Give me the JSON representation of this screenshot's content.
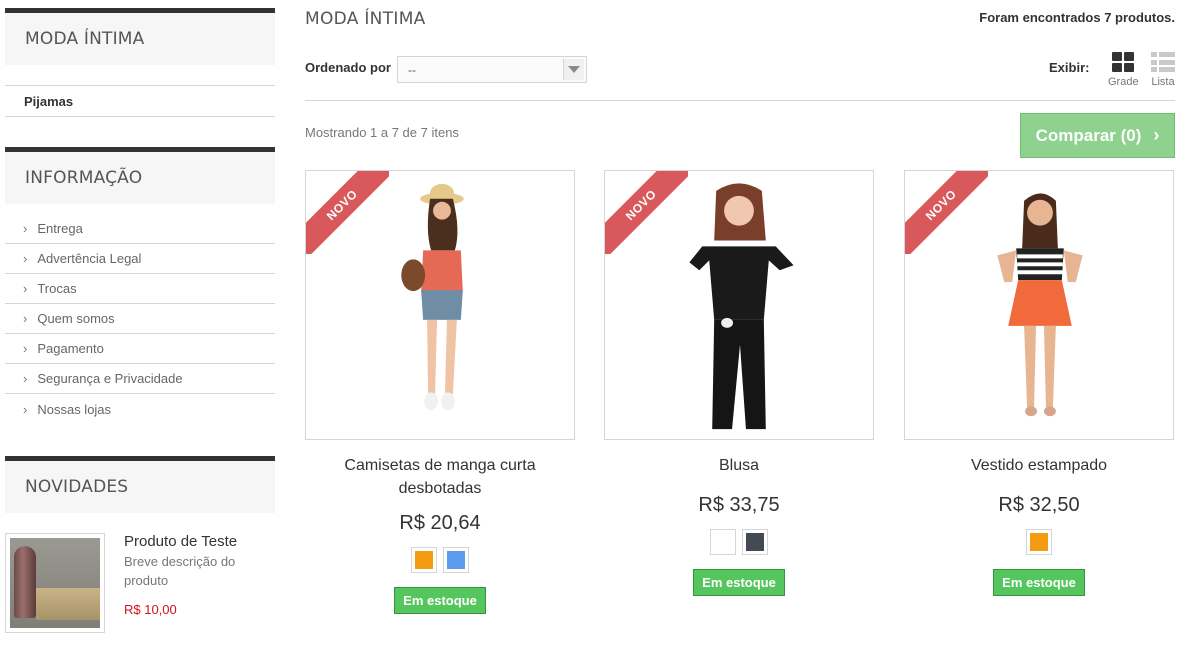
{
  "sidebar": {
    "category_title": "MODA ÍNTIMA",
    "category_items": [
      "Pijamas"
    ],
    "info_title": "INFORMAÇÃO",
    "info_items": [
      "Entrega",
      "Advertência Legal",
      "Trocas",
      "Quem somos",
      "Pagamento",
      "Segurança e Privacidade",
      "Nossas lojas"
    ],
    "new_title": "NOVIDADES",
    "new_product": {
      "name": "Produto de Teste",
      "description": "Breve descrição do produto",
      "price": "R$ 10,00"
    }
  },
  "main": {
    "title": "MODA ÍNTIMA",
    "found_text": "Foram encontrados 7 produtos.",
    "sort_label": "Ordenado por",
    "sort_value": "--",
    "view_label": "Exibir:",
    "view_grid": "Grade",
    "view_list": "Lista",
    "showing": "Mostrando 1 a 7 de 7 itens",
    "compare_label": "Comparar (0)"
  },
  "products": [
    {
      "badge": "NOVO",
      "name": "Camisetas de manga curta desbotadas",
      "price": "R$ 20,64",
      "swatches": [
        "#f39c11",
        "#5d9cec"
      ],
      "stock": "Em estoque",
      "icon": "model-photo-1"
    },
    {
      "badge": "NOVO",
      "name": "Blusa",
      "price": "R$ 33,75",
      "swatches": [
        "#ffffff",
        "#434a54"
      ],
      "stock": "Em estoque",
      "icon": "model-photo-2"
    },
    {
      "badge": "NOVO",
      "name": "Vestido estampado",
      "price": "R$ 32,50",
      "swatches": [
        "#f39c11"
      ],
      "stock": "Em estoque",
      "icon": "model-photo-3"
    }
  ],
  "colors": {
    "accent_dark": "#333333",
    "ribbon": "#d9585b",
    "compare": "#8fd18f",
    "stock": "#55c65e",
    "price_red": "#d0121a"
  }
}
